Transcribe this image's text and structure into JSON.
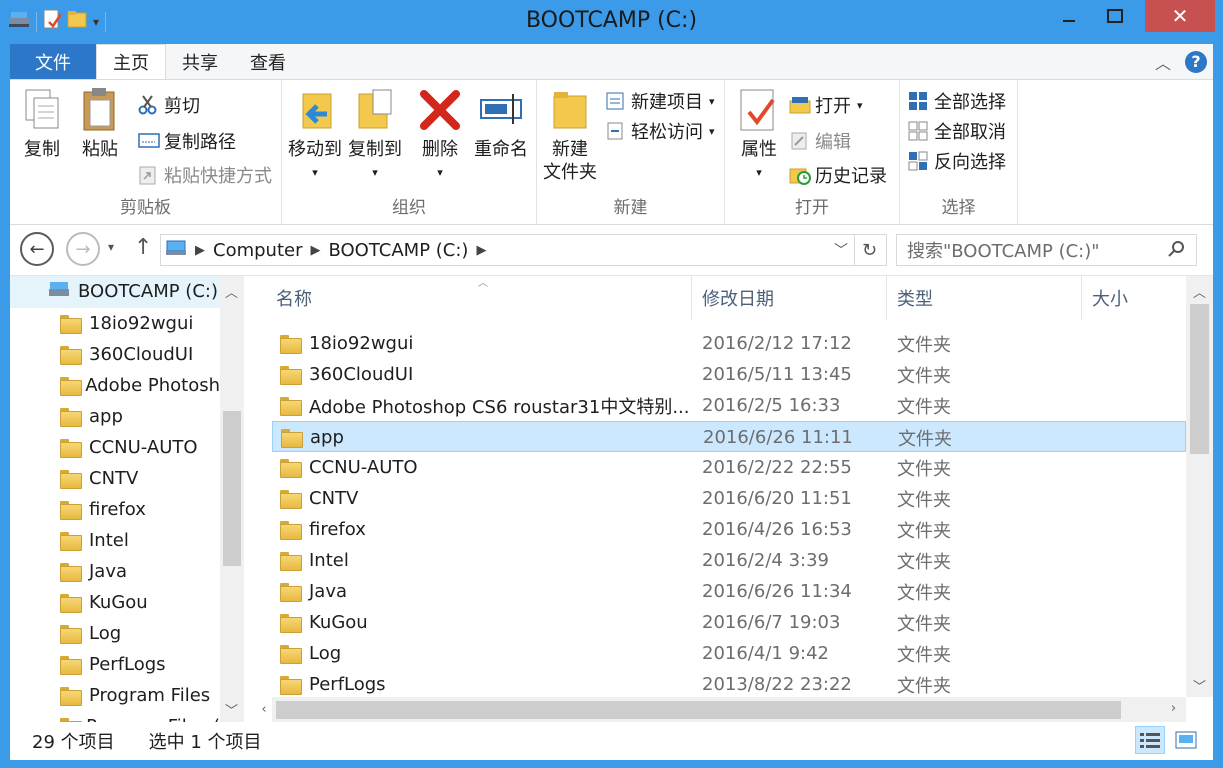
{
  "window": {
    "title": "BOOTCAMP (C:)",
    "controls": {
      "minimize": "—",
      "maximize": "☐",
      "close": "✕"
    }
  },
  "tabs": {
    "file": "文件",
    "home": "主页",
    "share": "共享",
    "view": "查看"
  },
  "ribbon": {
    "clipboard": {
      "label": "剪贴板",
      "copy": "复制",
      "paste": "粘贴",
      "cut": "剪切",
      "copy_path": "复制路径",
      "paste_shortcut": "粘贴快捷方式"
    },
    "organize": {
      "label": "组织",
      "move_to": "移动到",
      "copy_to": "复制到",
      "delete": "删除",
      "rename": "重命名"
    },
    "new": {
      "label": "新建",
      "new_folder_line1": "新建",
      "new_folder_line2": "文件夹",
      "new_item": "新建项目",
      "easy_access": "轻松访问"
    },
    "open": {
      "label": "打开",
      "properties": "属性",
      "open": "打开",
      "edit": "编辑",
      "history": "历史记录"
    },
    "select": {
      "label": "选择",
      "select_all": "全部选择",
      "select_none": "全部取消",
      "invert": "反向选择"
    }
  },
  "address": {
    "segments": [
      "Computer",
      "BOOTCAMP (C:)"
    ],
    "search_placeholder": "搜索\"BOOTCAMP (C:)\""
  },
  "nav_pane": {
    "drive": "BOOTCAMP (C:)",
    "items": [
      "18io92wgui",
      "360CloudUI",
      "Adobe Photosh",
      "app",
      "CCNU-AUTO",
      "CNTV",
      "firefox",
      "Intel",
      "Java",
      "KuGou",
      "Log",
      "PerfLogs",
      "Program Files",
      "Program Files ("
    ]
  },
  "columns": {
    "name": "名称",
    "date": "修改日期",
    "type": "类型",
    "size": "大小"
  },
  "files": [
    {
      "name": "18io92wgui",
      "date": "2016/2/12 17:12",
      "type": "文件夹"
    },
    {
      "name": "360CloudUI",
      "date": "2016/5/11 13:45",
      "type": "文件夹"
    },
    {
      "name": "Adobe Photoshop CS6  roustar31中文特别...",
      "date": "2016/2/5 16:33",
      "type": "文件夹"
    },
    {
      "name": "app",
      "date": "2016/6/26 11:11",
      "type": "文件夹"
    },
    {
      "name": "CCNU-AUTO",
      "date": "2016/2/22 22:55",
      "type": "文件夹"
    },
    {
      "name": "CNTV",
      "date": "2016/6/20 11:51",
      "type": "文件夹"
    },
    {
      "name": "firefox",
      "date": "2016/4/26 16:53",
      "type": "文件夹"
    },
    {
      "name": "Intel",
      "date": "2016/2/4 3:39",
      "type": "文件夹"
    },
    {
      "name": "Java",
      "date": "2016/6/26 11:34",
      "type": "文件夹"
    },
    {
      "name": "KuGou",
      "date": "2016/6/7 19:03",
      "type": "文件夹"
    },
    {
      "name": "Log",
      "date": "2016/4/1 9:42",
      "type": "文件夹"
    },
    {
      "name": "PerfLogs",
      "date": "2013/8/22 23:22",
      "type": "文件夹"
    }
  ],
  "selected_file": "app",
  "status": {
    "count": "29 个项目",
    "selection": "选中 1 个项目"
  }
}
